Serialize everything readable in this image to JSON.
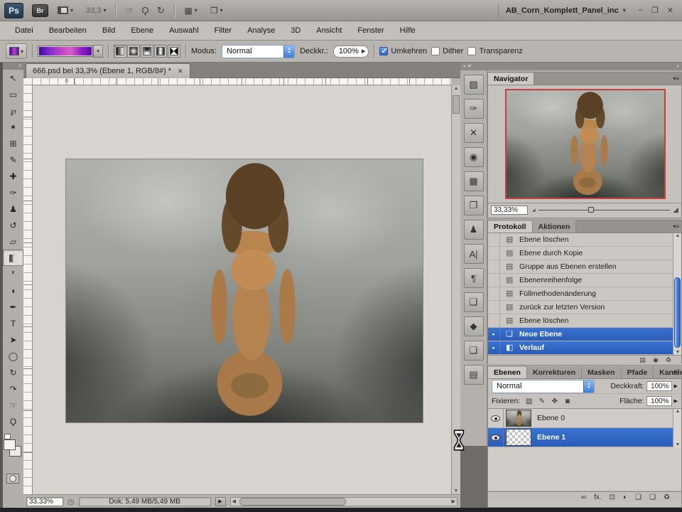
{
  "app": {
    "ps_logo": "Ps",
    "br_logo": "Br",
    "zoom_display": "33,3",
    "caret": "▾",
    "view_tools": [
      {
        "name": "hand-tool-icon",
        "glyph": "☞"
      },
      {
        "name": "zoom-tool-icon",
        "glyph": "Ϙ"
      },
      {
        "name": "rotate-view-icon",
        "glyph": "↻"
      }
    ],
    "window_title": "AB_Corn_Komplett_Panel_inc",
    "minimize": "–",
    "restore": "❐",
    "close": "✕"
  },
  "menu": {
    "items": [
      "Datei",
      "Bearbeiten",
      "Bild",
      "Ebene",
      "Auswahl",
      "Filter",
      "Analyse",
      "3D",
      "Ansicht",
      "Fenster",
      "Hilfe"
    ]
  },
  "options": {
    "modus_label": "Modus:",
    "modus_value": "Normal",
    "deckkraft_label": "Deckkr.:",
    "deckkraft_value": "100%",
    "gradient_colors": [
      "#43009e",
      "#7d2ad0",
      "#b743c6",
      "#d95fc8",
      "#8d20c6",
      "#5708aa"
    ],
    "checkboxes": [
      {
        "name": "umkehren-checkbox",
        "label": "Umkehren",
        "checked": true
      },
      {
        "name": "dither-checkbox",
        "label": "Dither",
        "checked": false
      },
      {
        "name": "transparenz-checkbox",
        "label": "Transparenz",
        "checked": false
      }
    ]
  },
  "tools": [
    {
      "name": "move-tool",
      "glyph": "↖"
    },
    {
      "name": "marquee-tool",
      "glyph": "▭"
    },
    {
      "name": "lasso-tool",
      "glyph": "℘"
    },
    {
      "name": "magic-wand-tool",
      "glyph": "✶"
    },
    {
      "name": "crop-tool",
      "glyph": "⊞"
    },
    {
      "name": "eyedropper-tool",
      "glyph": "✎"
    },
    {
      "name": "healing-brush-tool",
      "glyph": "✚"
    },
    {
      "name": "brush-tool",
      "glyph": "✑"
    },
    {
      "name": "clone-stamp-tool",
      "glyph": "♟"
    },
    {
      "name": "history-brush-tool",
      "glyph": "↺"
    },
    {
      "name": "eraser-tool",
      "glyph": "▱"
    },
    {
      "name": "gradient-tool",
      "glyph": "◧",
      "active": true
    },
    {
      "name": "blur-tool",
      "glyph": "❜"
    },
    {
      "name": "dodge-tool",
      "glyph": "◖"
    },
    {
      "name": "pen-tool",
      "glyph": "✒"
    },
    {
      "name": "type-tool",
      "glyph": "T"
    },
    {
      "name": "path-selection-tool",
      "glyph": "➤"
    },
    {
      "name": "shape-tool",
      "glyph": "◯"
    },
    {
      "name": "3d-rotate-tool",
      "glyph": "↻"
    },
    {
      "name": "3d-orbit-tool",
      "glyph": "↷"
    },
    {
      "name": "hand-tool",
      "glyph": "☞"
    },
    {
      "name": "zoom-tool",
      "glyph": "Ϙ"
    }
  ],
  "document": {
    "tab_title": "666.psd bei 33,3% (Ebene 1, RGB/8#) *",
    "tab_close": "✕",
    "ruler_zero": "0",
    "status": {
      "zoom": "33,33%",
      "clock_icon": "◷",
      "doc": "Dok: 5,49 MB/5,49 MB",
      "arrow": "▶"
    }
  },
  "dock": {
    "collapse": "»",
    "close": "✕",
    "icons": [
      {
        "name": "image-panel-icon",
        "glyph": "▨"
      },
      {
        "name": "brush-panel-icon",
        "glyph": "✑"
      },
      {
        "name": "tool-presets-panel-icon",
        "glyph": "✕"
      },
      {
        "name": "color-panel-icon",
        "glyph": "◉"
      },
      {
        "name": "swatches-panel-icon",
        "glyph": "▦"
      },
      {
        "name": "screen-panel-icon",
        "glyph": "❐"
      },
      {
        "name": "clone-source-panel-icon",
        "glyph": "♟"
      },
      {
        "name": "character-panel-icon",
        "glyph": "A|"
      },
      {
        "name": "paragraph-panel-icon",
        "glyph": "¶"
      },
      {
        "name": "layer-comps-panel-icon",
        "glyph": "❑"
      },
      {
        "name": "animation-panel-icon",
        "glyph": "◆"
      },
      {
        "name": "duplicate-panel-icon",
        "glyph": "❏"
      },
      {
        "name": "photo-panel-icon",
        "glyph": "▤"
      }
    ]
  },
  "navigator": {
    "tab": "Navigator",
    "menu_icon": "▾≡",
    "zoom": "33,33%",
    "proxy_border_color": "#c64040",
    "slider_small": "◢",
    "slider_large": "◢"
  },
  "history": {
    "tabs": [
      {
        "name": "tab-protokoll",
        "label": "Protokoll",
        "active": true
      },
      {
        "name": "tab-aktionen",
        "label": "Aktionen",
        "active": false
      }
    ],
    "menu_icon": "▾≡",
    "items": [
      {
        "name": "history-ebene-loeschen-1",
        "label": "Ebene löschen",
        "icon": "▤",
        "arrow": "",
        "selected": false
      },
      {
        "name": "history-ebene-durch-kopie",
        "label": "Ebene durch Kopie",
        "icon": "▤",
        "arrow": "",
        "selected": false
      },
      {
        "name": "history-gruppe-aus-ebenen",
        "label": "Gruppe aus Ebenen erstellen",
        "icon": "▤",
        "arrow": "",
        "selected": false
      },
      {
        "name": "history-ebenenreihenfolge",
        "label": "Ebenenreihenfolge",
        "icon": "▤",
        "arrow": "",
        "selected": false
      },
      {
        "name": "history-fuellmethodenaenderung",
        "label": "Füllmethodenänderung",
        "icon": "▤",
        "arrow": "",
        "selected": false
      },
      {
        "name": "history-zurueck-letzte-version",
        "label": "zurück zur letzten Version",
        "icon": "▤",
        "arrow": "",
        "selected": false
      },
      {
        "name": "history-ebene-loeschen-2",
        "label": "Ebene löschen",
        "icon": "▤",
        "arrow": "",
        "selected": false
      },
      {
        "name": "history-neue-ebene",
        "label": "Neue Ebene",
        "icon": "❏",
        "arrow": "▸",
        "selected": true
      },
      {
        "name": "history-verlauf",
        "label": "Verlauf",
        "icon": "◧",
        "arrow": "▸",
        "selected": true
      }
    ],
    "buttons": [
      {
        "name": "new-document-from-state-button",
        "glyph": "▤"
      },
      {
        "name": "new-snapshot-button",
        "glyph": "◉"
      },
      {
        "name": "delete-state-button",
        "glyph": "♻"
      }
    ],
    "scroll_up": "▲",
    "scroll_down": "▼"
  },
  "layers": {
    "tabs": [
      {
        "name": "tab-ebenen",
        "label": "Ebenen",
        "active": true
      },
      {
        "name": "tab-korrekturen",
        "label": "Korrekturen",
        "active": false
      },
      {
        "name": "tab-masken",
        "label": "Masken",
        "active": false
      },
      {
        "name": "tab-pfade",
        "label": "Pfade",
        "active": false
      },
      {
        "name": "tab-kanaele",
        "label": "Kanäle",
        "active": false
      }
    ],
    "menu_icon": "▾≡",
    "blend_mode": "Normal",
    "deckkraft_label": "Deckkraft:",
    "deckkraft_value": "100%",
    "fixieren_label": "Fixieren:",
    "fixieren_icons": [
      {
        "name": "lock-transparency-icon",
        "glyph": "▨"
      },
      {
        "name": "lock-paint-icon",
        "glyph": "✎"
      },
      {
        "name": "lock-position-icon",
        "glyph": "✥"
      },
      {
        "name": "lock-all-icon",
        "glyph": "◙"
      }
    ],
    "flaeche_label": "Fläche:",
    "flaeche_value": "100%",
    "rows": [
      {
        "name": "Ebene 0",
        "thumb": "photo",
        "selected": false
      },
      {
        "name": "Ebene 1",
        "thumb": "checker",
        "selected": true
      }
    ],
    "buttons": [
      {
        "name": "link-layers-button",
        "glyph": "∞"
      },
      {
        "name": "layer-style-button",
        "glyph": "fx."
      },
      {
        "name": "add-mask-button",
        "glyph": "⊡"
      },
      {
        "name": "adjustment-layer-button",
        "glyph": "◐"
      },
      {
        "name": "new-group-button",
        "glyph": "❑"
      },
      {
        "name": "new-layer-button",
        "glyph": "❏"
      },
      {
        "name": "delete-layer-button",
        "glyph": "♻"
      }
    ]
  },
  "colors": {
    "selection_blue": "#2e63c0",
    "navigator_proxy_red": "#c64040",
    "chrome_gray": "#b6b3af"
  }
}
